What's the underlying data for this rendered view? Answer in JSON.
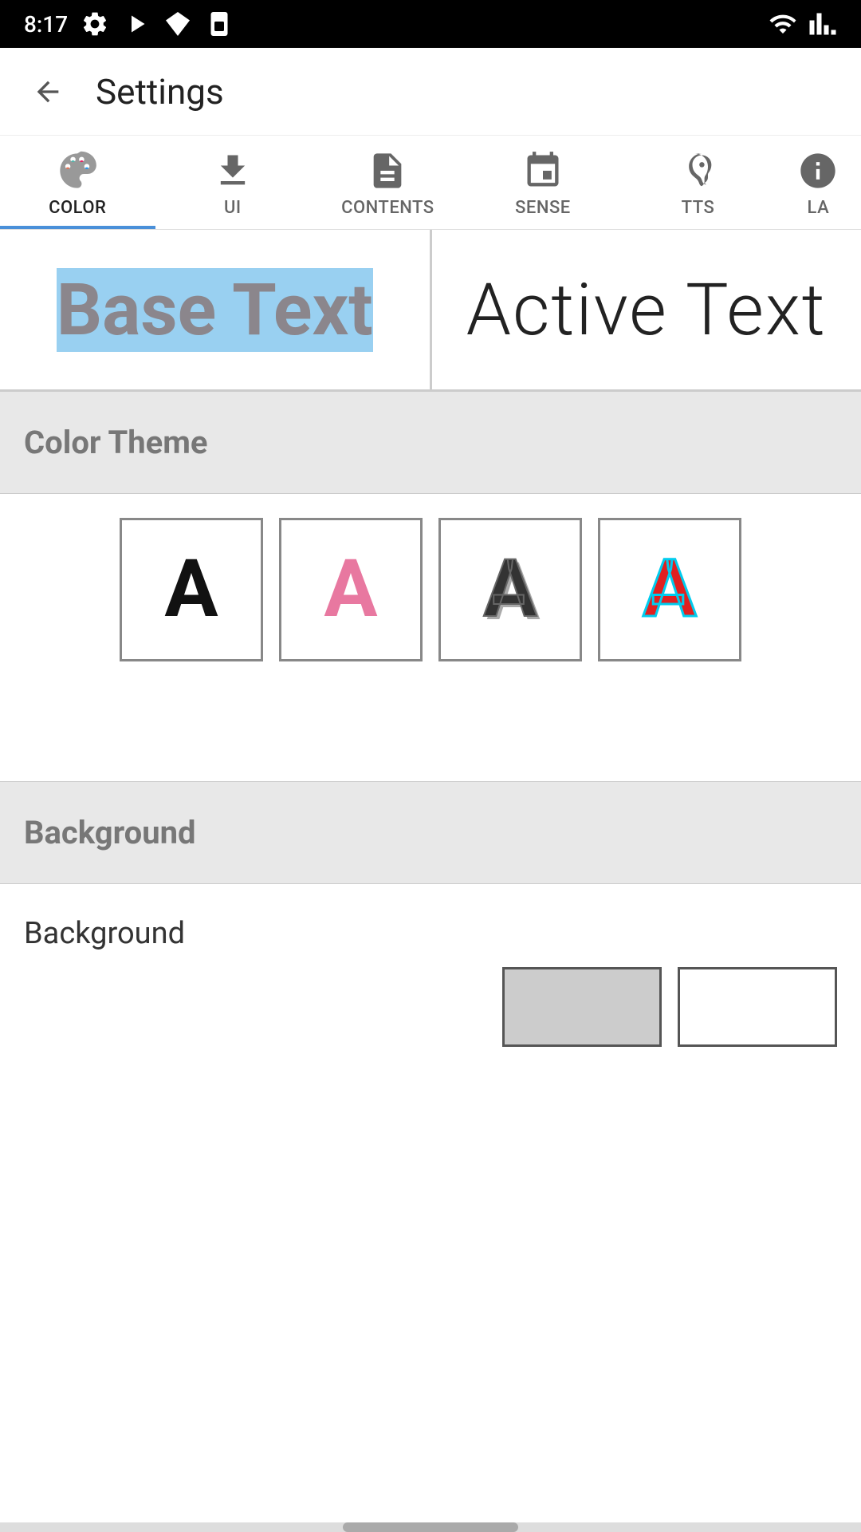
{
  "statusBar": {
    "time": "8:17",
    "icons": [
      "settings",
      "play",
      "diamond",
      "sim"
    ]
  },
  "header": {
    "backLabel": "←",
    "title": "Settings"
  },
  "tabs": [
    {
      "id": "color",
      "label": "COLOR",
      "icon": "palette",
      "active": true
    },
    {
      "id": "ui",
      "label": "UI",
      "icon": "download-box",
      "active": false
    },
    {
      "id": "contents",
      "label": "CONTENTS",
      "icon": "document",
      "active": false
    },
    {
      "id": "sense",
      "label": "SENSE",
      "icon": "clock-download",
      "active": false
    },
    {
      "id": "tts",
      "label": "TTS",
      "icon": "hearing",
      "active": false
    },
    {
      "id": "la",
      "label": "LA",
      "icon": "more",
      "active": false
    }
  ],
  "preview": {
    "baseText": "Base Text",
    "activeText": "Active Text"
  },
  "colorTheme": {
    "sectionTitle": "Color Theme",
    "options": [
      {
        "id": 1,
        "letter": "A",
        "style": "plain-black"
      },
      {
        "id": 2,
        "letter": "A",
        "style": "pink"
      },
      {
        "id": 3,
        "letter": "A",
        "style": "shadow"
      },
      {
        "id": 4,
        "letter": "A",
        "style": "red-cyan"
      }
    ]
  },
  "background": {
    "sectionTitle": "Background",
    "rowLabel": "Background"
  }
}
